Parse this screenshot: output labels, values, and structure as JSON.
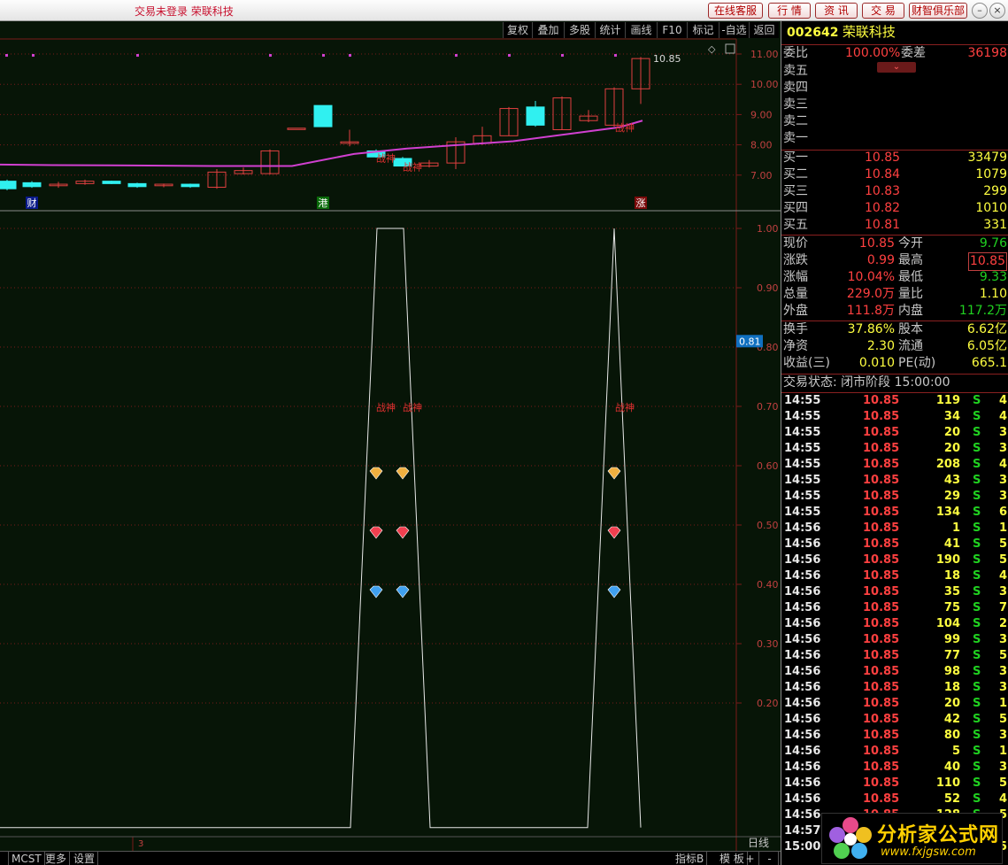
{
  "titlebar": {
    "login_status": "交易未登录  荣联科技",
    "buttons": [
      "在线客服",
      "行  情",
      "资  讯",
      "交  易",
      "财智俱乐部"
    ]
  },
  "toolbar": [
    "复权",
    "叠加",
    "多股",
    "统计",
    "画线",
    "F10",
    "标记",
    "-自选",
    "返回"
  ],
  "chart": {
    "price_labels": [
      "11.00",
      "10.00",
      "9.00",
      "8.00",
      "7.00"
    ],
    "high_label": "10.85",
    "event_tags": [
      "财",
      "港",
      "涨"
    ],
    "indicator_labels": [
      "1.00",
      "0.90",
      "0.80",
      "0.70",
      "0.60",
      "0.50",
      "0.40",
      "0.30",
      "0.20"
    ],
    "current_value": "0.81",
    "signal_text": "战神"
  },
  "stock": {
    "code": "002642",
    "name": "荣联科技",
    "webi_label": "委比",
    "webi_value": "100.00%",
    "weicha_label": "委差",
    "weicha_value": "36198",
    "sell": [
      {
        "label": "卖五",
        "price": "",
        "vol": ""
      },
      {
        "label": "卖四",
        "price": "",
        "vol": ""
      },
      {
        "label": "卖三",
        "price": "",
        "vol": ""
      },
      {
        "label": "卖二",
        "price": "",
        "vol": ""
      },
      {
        "label": "卖一",
        "price": "",
        "vol": ""
      }
    ],
    "buy": [
      {
        "label": "买一",
        "price": "10.85",
        "vol": "33479"
      },
      {
        "label": "买二",
        "price": "10.84",
        "vol": "1079"
      },
      {
        "label": "买三",
        "price": "10.83",
        "vol": "299"
      },
      {
        "label": "买四",
        "price": "10.82",
        "vol": "1010"
      },
      {
        "label": "买五",
        "price": "10.81",
        "vol": "331"
      }
    ],
    "quote": [
      {
        "l1": "现价",
        "v1": "10.85",
        "l2": "今开",
        "v2": "9.76"
      },
      {
        "l1": "涨跌",
        "v1": "0.99",
        "l2": "最高",
        "v2": "10.85"
      },
      {
        "l1": "涨幅",
        "v1": "10.04%",
        "l2": "最低",
        "v2": "9.33"
      },
      {
        "l1": "总量",
        "v1": "229.0万",
        "l2": "量比",
        "v2": "1.10"
      },
      {
        "l1": "外盘",
        "v1": "111.8万",
        "l2": "内盘",
        "v2": "117.2万"
      }
    ],
    "fund": [
      {
        "l1": "换手",
        "v1": "37.86%",
        "l2": "股本",
        "v2": "6.62亿"
      },
      {
        "l1": "净资",
        "v1": "2.30",
        "l2": "流通",
        "v2": "6.05亿"
      },
      {
        "l1": "收益(三)",
        "v1": "0.010",
        "l2": "PE(动)",
        "v2": "665.1"
      }
    ],
    "trade_status": "交易状态: 闭市阶段 15:00:00"
  },
  "ticks": [
    {
      "t": "14:55",
      "p": "10.85",
      "v": "119",
      "s": "S",
      "n": "4"
    },
    {
      "t": "14:55",
      "p": "10.85",
      "v": "34",
      "s": "S",
      "n": "4"
    },
    {
      "t": "14:55",
      "p": "10.85",
      "v": "20",
      "s": "S",
      "n": "3"
    },
    {
      "t": "14:55",
      "p": "10.85",
      "v": "20",
      "s": "S",
      "n": "3"
    },
    {
      "t": "14:55",
      "p": "10.85",
      "v": "208",
      "s": "S",
      "n": "4"
    },
    {
      "t": "14:55",
      "p": "10.85",
      "v": "43",
      "s": "S",
      "n": "3"
    },
    {
      "t": "14:55",
      "p": "10.85",
      "v": "29",
      "s": "S",
      "n": "3"
    },
    {
      "t": "14:55",
      "p": "10.85",
      "v": "134",
      "s": "S",
      "n": "6"
    },
    {
      "t": "14:56",
      "p": "10.85",
      "v": "1",
      "s": "S",
      "n": "1"
    },
    {
      "t": "14:56",
      "p": "10.85",
      "v": "41",
      "s": "S",
      "n": "5"
    },
    {
      "t": "14:56",
      "p": "10.85",
      "v": "190",
      "s": "S",
      "n": "5"
    },
    {
      "t": "14:56",
      "p": "10.85",
      "v": "18",
      "s": "S",
      "n": "4"
    },
    {
      "t": "14:56",
      "p": "10.85",
      "v": "35",
      "s": "S",
      "n": "3"
    },
    {
      "t": "14:56",
      "p": "10.85",
      "v": "75",
      "s": "S",
      "n": "7"
    },
    {
      "t": "14:56",
      "p": "10.85",
      "v": "104",
      "s": "S",
      "n": "2"
    },
    {
      "t": "14:56",
      "p": "10.85",
      "v": "99",
      "s": "S",
      "n": "3"
    },
    {
      "t": "14:56",
      "p": "10.85",
      "v": "77",
      "s": "S",
      "n": "5"
    },
    {
      "t": "14:56",
      "p": "10.85",
      "v": "98",
      "s": "S",
      "n": "3"
    },
    {
      "t": "14:56",
      "p": "10.85",
      "v": "18",
      "s": "S",
      "n": "3"
    },
    {
      "t": "14:56",
      "p": "10.85",
      "v": "20",
      "s": "S",
      "n": "1"
    },
    {
      "t": "14:56",
      "p": "10.85",
      "v": "42",
      "s": "S",
      "n": "5"
    },
    {
      "t": "14:56",
      "p": "10.85",
      "v": "80",
      "s": "S",
      "n": "3"
    },
    {
      "t": "14:56",
      "p": "10.85",
      "v": "5",
      "s": "S",
      "n": "1"
    },
    {
      "t": "14:56",
      "p": "10.85",
      "v": "40",
      "s": "S",
      "n": "3"
    },
    {
      "t": "14:56",
      "p": "10.85",
      "v": "110",
      "s": "S",
      "n": "5"
    },
    {
      "t": "14:56",
      "p": "10.85",
      "v": "52",
      "s": "S",
      "n": "4"
    },
    {
      "t": "14:56",
      "p": "10.85",
      "v": "128",
      "s": "S",
      "n": "5"
    },
    {
      "t": "14:57",
      "p": "10.85",
      "v": "",
      "s": "",
      "n": ""
    },
    {
      "t": "15:00",
      "p": "",
      "v": "",
      "s": "",
      "n": "5"
    }
  ],
  "bottom": {
    "tabs": [
      "MCST",
      "更多",
      "设置"
    ],
    "right_tabs": [
      "指标B",
      "模  板",
      "+",
      "-"
    ],
    "period": "日线",
    "num": "3"
  },
  "watermark": {
    "title": "分析家公式网",
    "url": "www.fxjgsw.com"
  },
  "colors": {
    "up": "#ff4040",
    "down": "#30f0f0",
    "ma": "#d040d0",
    "grid": "#7a1a1a"
  }
}
